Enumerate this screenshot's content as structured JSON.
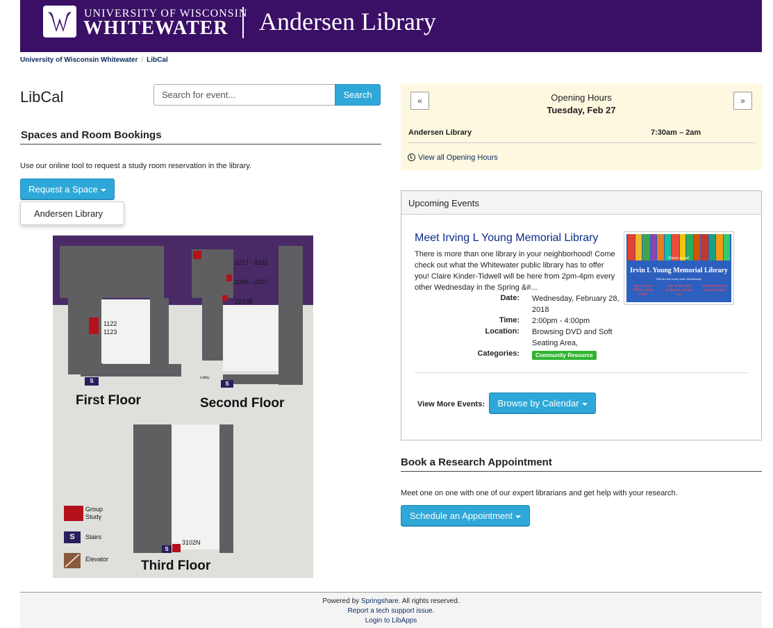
{
  "banner": {
    "university_line1": "UNIVERSITY OF WISCONSIN",
    "university_line2": "WHITEWATER",
    "library_name": "Andersen Library",
    "brand_color": "#3a0f66"
  },
  "breadcrumb": {
    "items": [
      "University of Wisconsin Whitewater",
      "LibCal"
    ],
    "separator": "/"
  },
  "page": {
    "title": "LibCal"
  },
  "search": {
    "placeholder": "Search for event...",
    "button_label": "Search"
  },
  "spaces": {
    "heading": "Spaces and Room Bookings",
    "description": "Use our online tool to request a study room reservation in the library.",
    "request_button": "Request a Space",
    "dropdown_items": [
      "Andersen Library"
    ]
  },
  "floor_map": {
    "room_labels": [
      "1122",
      "1123",
      "2217 - 2232",
      "2206 - 2207",
      "2210B",
      "3102N",
      "Lobby"
    ],
    "floors": [
      "First Floor",
      "Second Floor",
      "Third Floor"
    ],
    "stairs_symbol": "S",
    "legend": [
      {
        "label": "Group Study",
        "color": "#b3121b"
      },
      {
        "label": "Stairs",
        "color": "#2a1d5c"
      },
      {
        "label": "Elevator",
        "color": "#8a5a3c"
      }
    ]
  },
  "hours": {
    "prev_label": "«",
    "next_label": "»",
    "title": "Opening Hours",
    "date": "Tuesday, Feb 27",
    "location": "Andersen Library",
    "time": "7:30am – 2am",
    "view_all_link": "View all Opening Hours",
    "panel_color": "#fdf8df"
  },
  "events": {
    "header": "Upcoming Events",
    "event": {
      "title": "Meet Irving L Young Memorial Library",
      "description": "There is more than one library in your neighborhood! Come check out what the Whitewater public library has to offer you! Claire Kinder-Tidwell will be here from 2pm-4pm every other Wednesday in the Spring &#...",
      "date_label": "Date:",
      "date_value": "Wednesday, February 28, 2018",
      "time_label": "Time:",
      "time_value": "2:00pm - 4:00pm",
      "location_label": "Location:",
      "location_value": "Browsing DVD and Soft Seating Area,",
      "categories_label": "Categories:",
      "category_badge": "Community Resource",
      "badge_color": "#2fb52f",
      "thumbnail": {
        "small_text": "Check us out!",
        "title": "Irvin L Young Memorial Library",
        "subtitle": "Will be here every other Wednesday",
        "col1": "Sign up for a FREE Library Card!",
        "col2": "See all the new programs coming up!",
        "col3": "Learn about our amazing place!"
      }
    },
    "view_more_label": "View More Events:",
    "browse_button": "Browse by Calendar"
  },
  "research": {
    "heading": "Book a Research Appointment",
    "description": "Meet one on one with one of our expert librarians and get help with your research.",
    "schedule_button": "Schedule an Appointment"
  },
  "footer": {
    "powered_prefix": "Powered by ",
    "powered_link": "Springshare",
    "powered_suffix": ". All rights reserved.",
    "report_link": "Report a tech support issue.",
    "login_link": "Login to LibApps"
  },
  "accent_color": "#2ea8d8"
}
